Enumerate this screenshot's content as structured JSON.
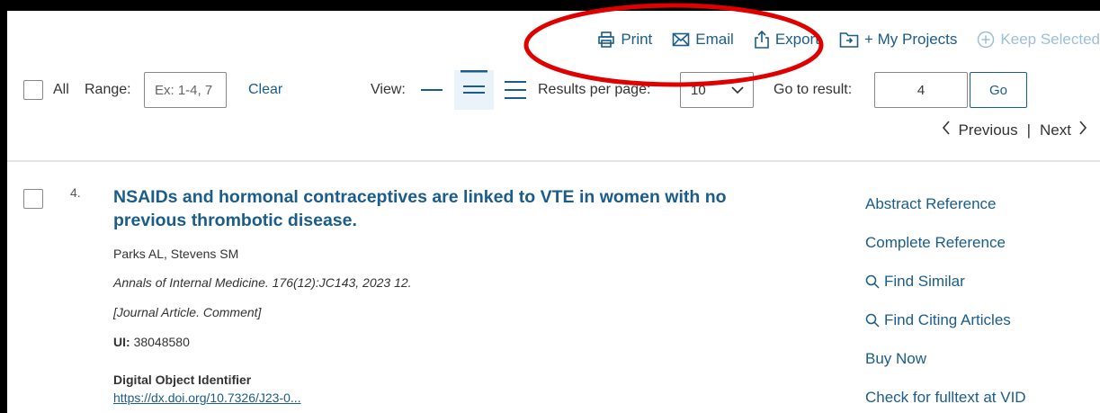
{
  "toolbar": {
    "actions": [
      {
        "label": "Print",
        "icon": "printer-icon"
      },
      {
        "label": "Email",
        "icon": "envelope-icon"
      },
      {
        "label": "Export",
        "icon": "export-icon"
      },
      {
        "label": "+ My Projects",
        "icon": "folder-icon"
      },
      {
        "label": "Keep Selected",
        "icon": "plus-circle-icon",
        "disabled": true
      }
    ]
  },
  "filters": {
    "all_label": "All",
    "range_label": "Range:",
    "range_placeholder": "Ex: 1-4, 7",
    "clear_label": "Clear",
    "view_label": "View:",
    "view_options": [
      "title-only-view-icon",
      "standard-view-icon",
      "full-view-icon"
    ],
    "view_selected": "standard-view-icon",
    "results_per_page_label": "Results per page:",
    "results_per_page_value": "10",
    "goto_label": "Go to result:",
    "goto_value": "4",
    "go_button": "Go"
  },
  "pager": {
    "previous": "Previous",
    "separator": "|",
    "next": "Next"
  },
  "result": {
    "number": "4.",
    "title": "NSAIDs and hormonal contraceptives are linked to VTE in women with no previous thrombotic disease.",
    "authors": "Parks AL, Stevens SM",
    "source": "Annals of Internal Medicine. 176(12):JC143, 2023 12.",
    "pub_type": "[Journal Article. Comment]",
    "ui_label": "UI:",
    "ui_value": "38048580",
    "doi_label": "Digital Object Identifier",
    "doi_link": "https://dx.doi.org/10.7326/J23-0..."
  },
  "side_links": {
    "abstract": "Abstract Reference",
    "complete": "Complete Reference",
    "find_similar": "Find Similar",
    "find_citing": "Find Citing Articles",
    "buy_now": "Buy Now",
    "check_fulltext": "Check for fulltext at VID"
  },
  "colors": {
    "link": "#1a5c8a",
    "annotation": "#e00000",
    "active_view_bg": "#eaf2fa"
  }
}
